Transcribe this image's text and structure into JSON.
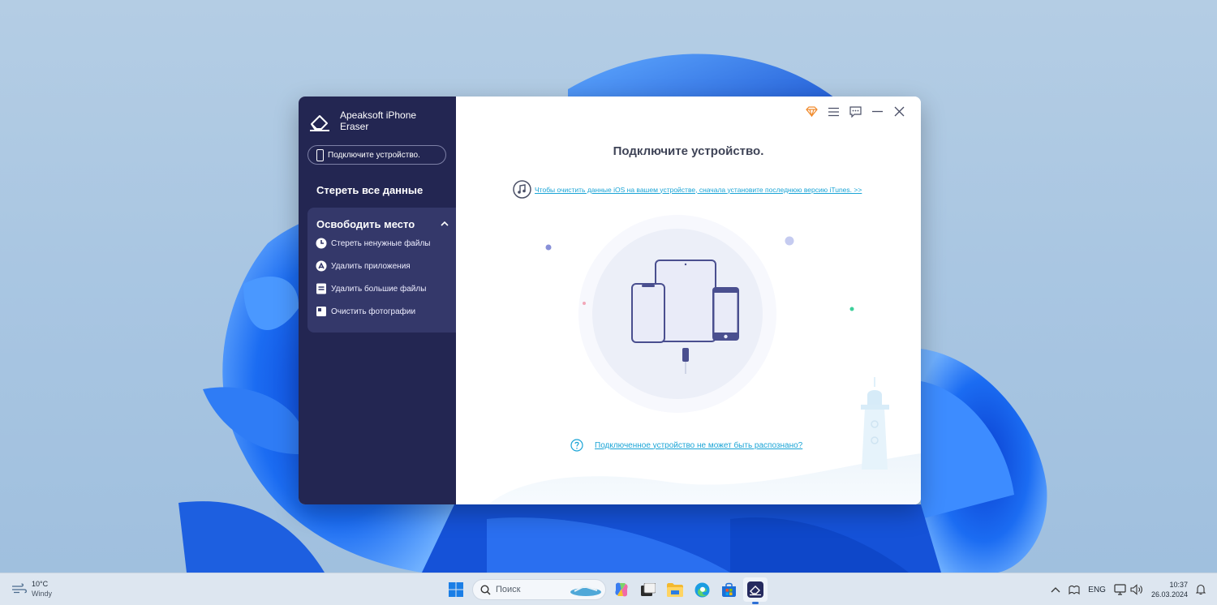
{
  "app": {
    "name": "Apeaksoft iPhone Eraser",
    "device_pill": "Подключите устройство.",
    "nav_erase_all": "Стереть все данные",
    "free_space": {
      "title": "Освободить место",
      "items": [
        {
          "label": "Стереть ненужные файлы",
          "icon": "clock-icon"
        },
        {
          "label": "Удалить приложения",
          "icon": "app-store-icon"
        },
        {
          "label": "Удалить большие файлы",
          "icon": "file-icon"
        },
        {
          "label": "Очистить фотографии",
          "icon": "photo-icon"
        }
      ]
    },
    "main": {
      "title": "Подключите устройство.",
      "itunes_link": "Чтобы очистить данные iOS на вашем устройстве, сначала установите последнюю версию iTunes. >>",
      "help_link": "Подключенное устройство не может быть распознано?"
    },
    "window_icons": [
      "diamond-icon",
      "menu-icon",
      "feedback-icon",
      "minimize-icon",
      "close-icon"
    ]
  },
  "taskbar": {
    "weather_temp": "10°C",
    "weather_desc": "Windy",
    "search_placeholder": "Поиск",
    "language": "ENG",
    "time": "10:37",
    "date": "26.03.2024"
  },
  "colors": {
    "sidebar": "#232652",
    "sidebar_active": "#34386a",
    "link": "#1aa4d6",
    "accent_orange": "#f08a2c"
  }
}
